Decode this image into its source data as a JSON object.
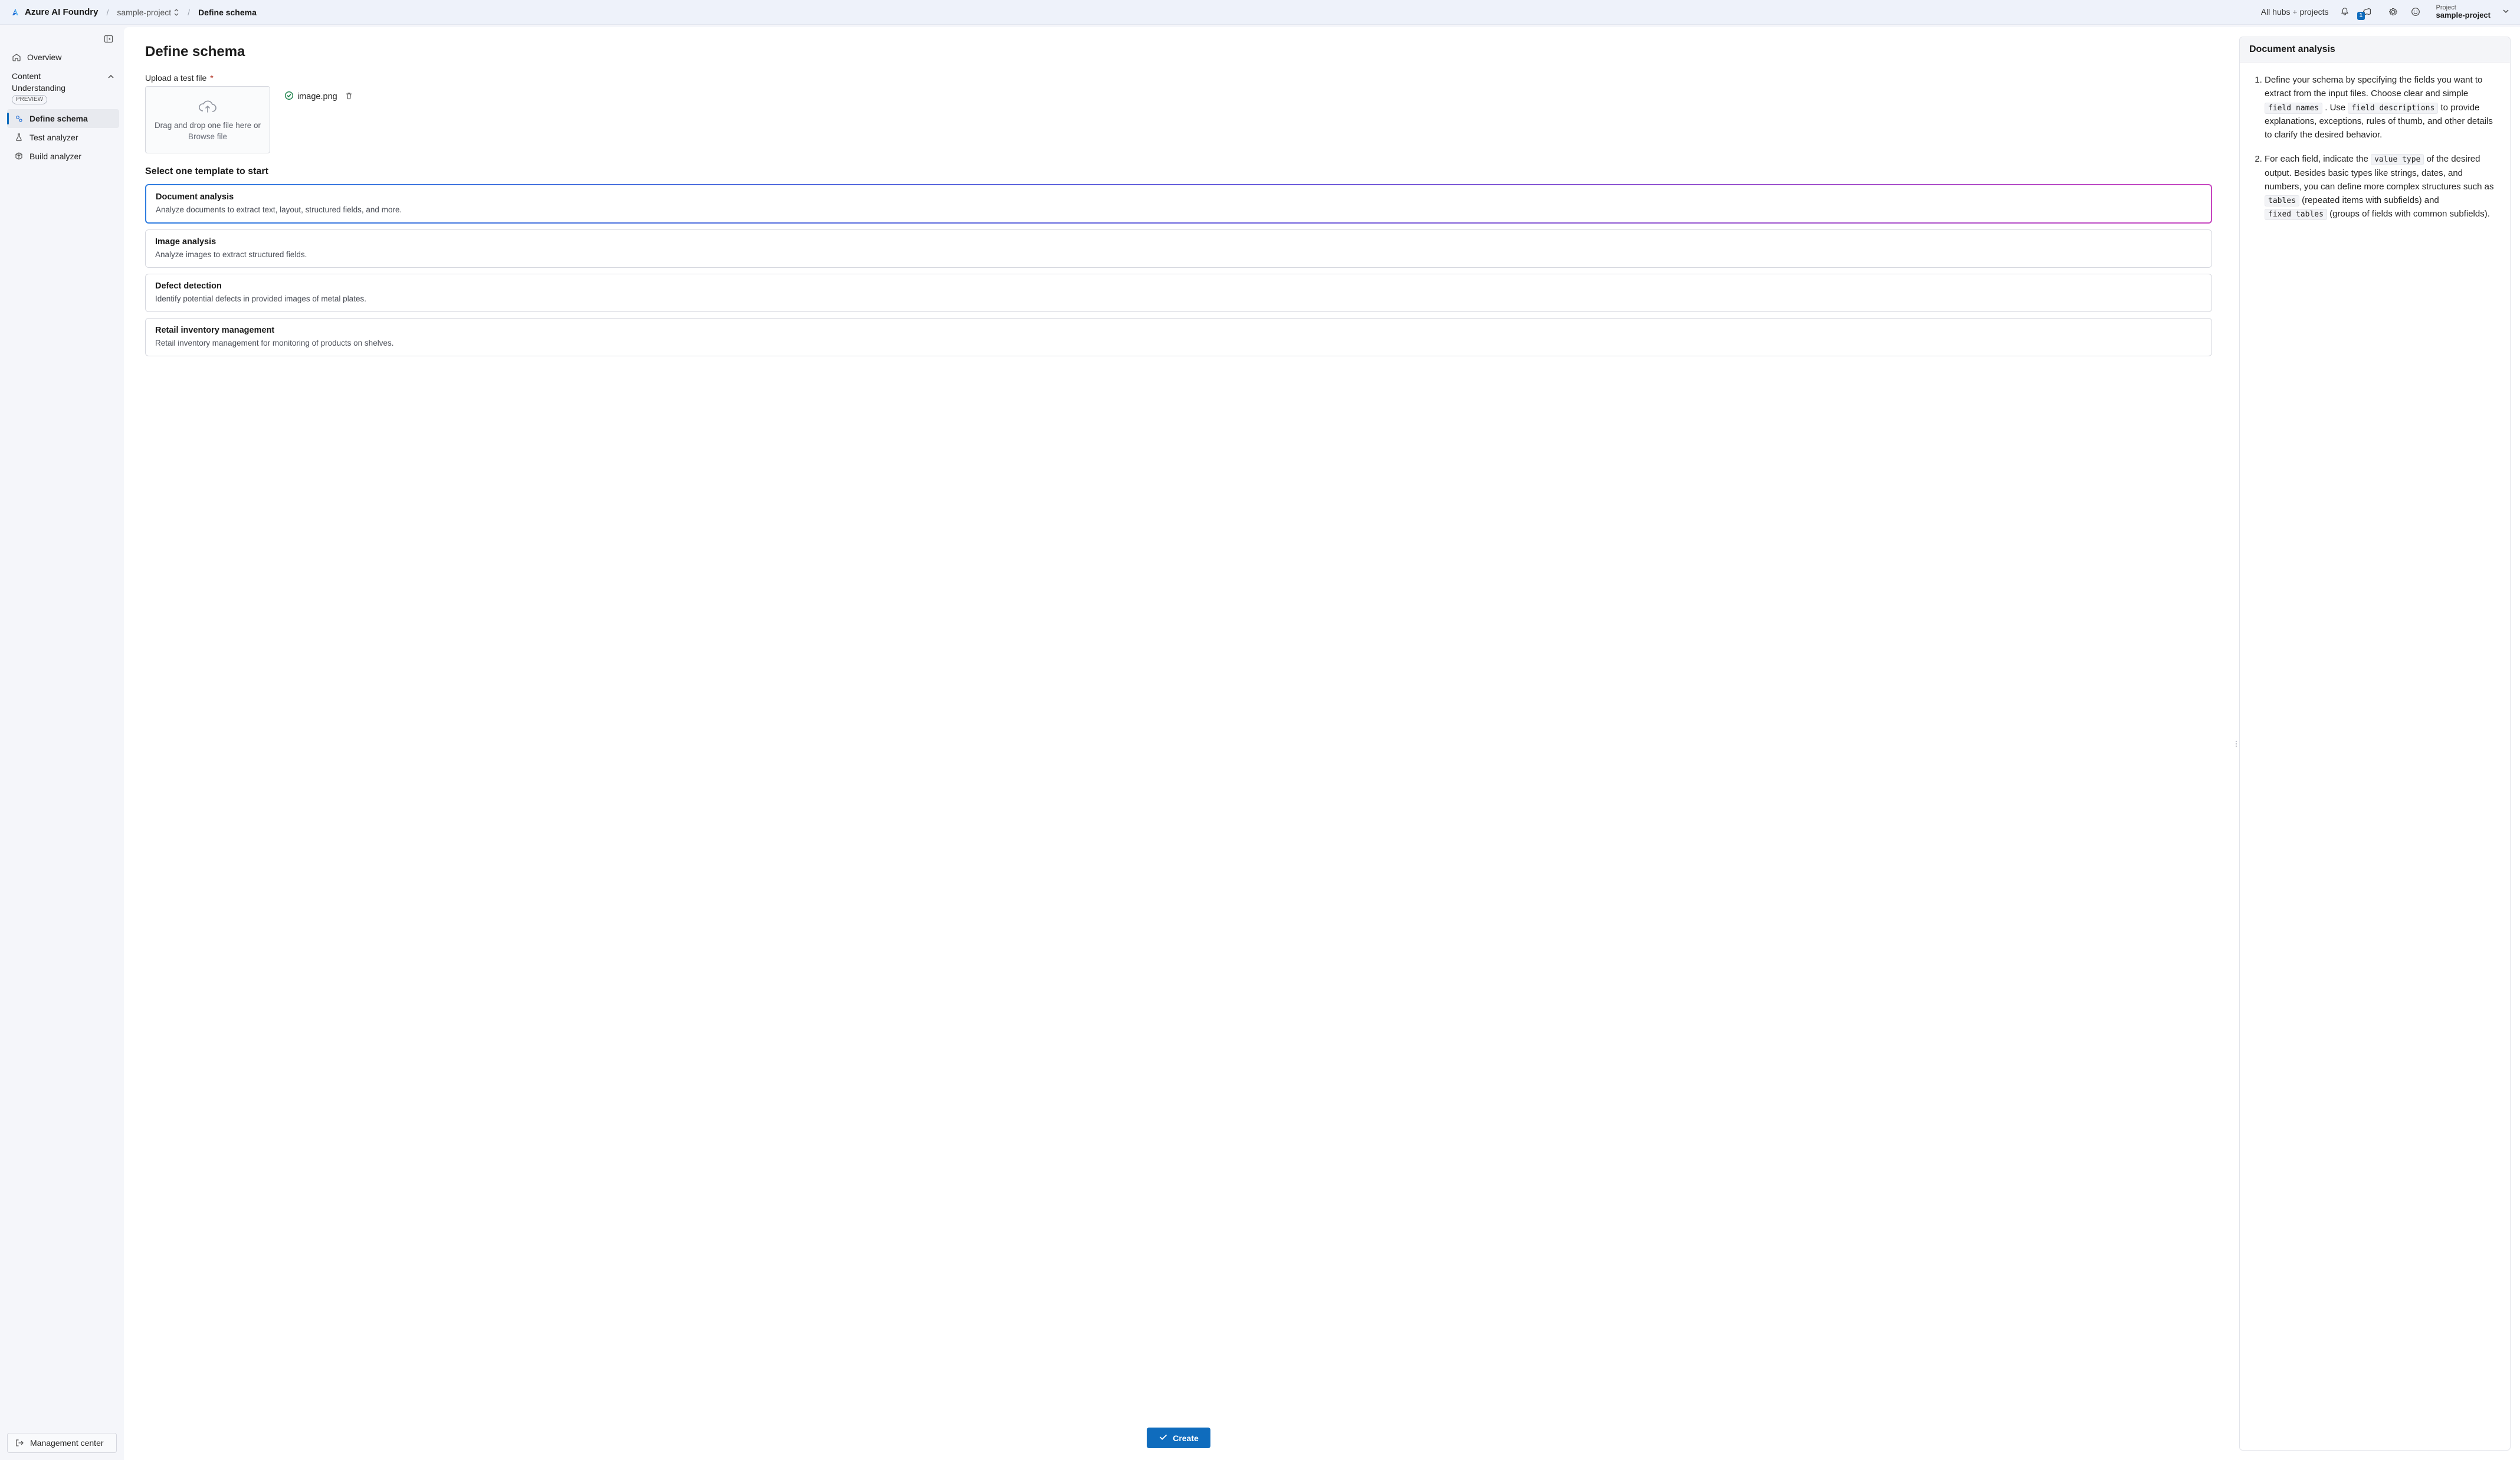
{
  "topbar": {
    "brand": "Azure AI Foundry",
    "breadcrumb_project": "sample-project",
    "breadcrumb_current": "Define schema",
    "all_hubs_link": "All hubs + projects",
    "announce_badge": "1",
    "project_label": "Project",
    "project_value": "sample-project"
  },
  "sidenav": {
    "overview": "Overview",
    "group_title_line1": "Content",
    "group_title_line2": "Understanding",
    "group_badge": "PREVIEW",
    "define_schema": "Define schema",
    "test_analyzer": "Test analyzer",
    "build_analyzer": "Build analyzer",
    "management_center": "Management center"
  },
  "main": {
    "heading": "Define schema",
    "upload_label": "Upload a test file",
    "dropzone_line1": "Drag and drop one file here or",
    "dropzone_browse": "Browse file",
    "uploaded_filename": "image.png",
    "select_template_heading": "Select one template to start",
    "templates": [
      {
        "title": "Document analysis",
        "desc": "Analyze documents to extract text, layout, structured fields, and more.",
        "selected": true
      },
      {
        "title": "Image analysis",
        "desc": "Analyze images to extract structured fields.",
        "selected": false
      },
      {
        "title": "Defect detection",
        "desc": "Identify potential defects in provided images of metal plates.",
        "selected": false
      },
      {
        "title": "Retail inventory management",
        "desc": "Retail inventory management for monitoring of products on shelves.",
        "selected": false
      }
    ],
    "create_button": "Create"
  },
  "right": {
    "header": "Document analysis",
    "step1_pre": "Define your schema by specifying the fields you want to extract from the input files. Choose clear and simple ",
    "step1_code1": "field names",
    "step1_mid1": " . Use ",
    "step1_code2": "field descriptions",
    "step1_post": " to provide explanations, exceptions, rules of thumb, and other details to clarify the desired behavior.",
    "step2_pre": "For each field, indicate the ",
    "step2_code1": "value type",
    "step2_mid1": " of the desired output. Besides basic types like strings, dates, and numbers, you can define more complex structures such as ",
    "step2_code2": "tables",
    "step2_mid2": " (repeated items with subfields) and ",
    "step2_code3": "fixed tables",
    "step2_post": " (groups of fields with common subfields)."
  }
}
